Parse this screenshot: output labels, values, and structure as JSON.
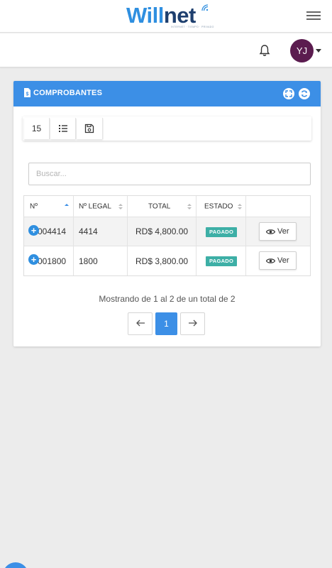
{
  "brand": {
    "name_part1": "Will",
    "name_part2": "net",
    "tagline": "INTERNET · TIEMPO · PRIVADO",
    "accent": "#2f8fe0",
    "dark": "#1e3f6e"
  },
  "header": {
    "menu_icon": "hamburger-icon",
    "notifications_icon": "bell-icon"
  },
  "user": {
    "initials": "YJ",
    "avatar_color": "#5b1c4f"
  },
  "panel": {
    "title": "COMPROBANTES",
    "header_color": "#3c8fe6",
    "header_icons": [
      "expand-icon",
      "refresh-icon"
    ],
    "toolbar": {
      "page_size": "15",
      "columns_icon": "list-icon",
      "export_icon": "save-icon"
    },
    "search": {
      "placeholder": "Buscar...",
      "value": ""
    },
    "table": {
      "columns": [
        "Nº",
        "Nº LEGAL",
        "TOTAL",
        "ESTADO",
        ""
      ],
      "rows": [
        {
          "numero": "004414",
          "legal": "4414",
          "total": "RD$ 4,800.00",
          "estado": "PAGADO",
          "accion": "Ver"
        },
        {
          "numero": "001800",
          "legal": "1800",
          "total": "RD$ 3,800.00",
          "estado": "PAGADO",
          "accion": "Ver"
        }
      ]
    },
    "info": "Mostrando de 1 al 2 de un total de 2",
    "pagination": {
      "prev": "←",
      "current": "1",
      "next": "→"
    }
  }
}
